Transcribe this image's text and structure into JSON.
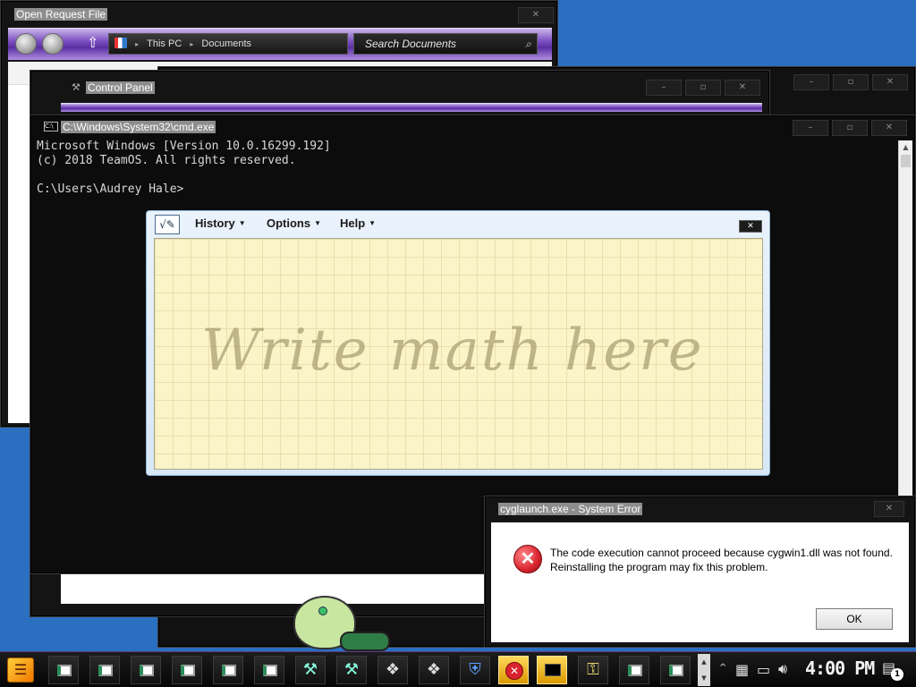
{
  "desktop": {
    "background_color": "#2a6fc0"
  },
  "open_request_file": {
    "title": "Open Request File",
    "close_glyph": "✕",
    "breadcrumb": [
      "This PC",
      "Documents"
    ],
    "search_placeholder": "Search Documents"
  },
  "control_panel": {
    "title": "Control Panel",
    "controls": {
      "minimize": "–",
      "maximize": "▫",
      "close": "✕"
    }
  },
  "cmd": {
    "title": "C:\\Windows\\System32\\cmd.exe",
    "lines": [
      "Microsoft Windows [Version 10.0.16299.192]",
      "(c) 2018 TeamOS. All rights reserved.",
      "",
      "C:\\Users\\Audrey Hale>"
    ],
    "controls": {
      "minimize": "–",
      "maximize": "▫",
      "close": "✕"
    }
  },
  "math_input": {
    "menus": [
      "History",
      "Options",
      "Help"
    ],
    "close_glyph": "✕",
    "hint": "Write math here",
    "colors": {
      "canvas": "#fbf4c8",
      "frame": "#d8e7f6"
    }
  },
  "error_dialog": {
    "title": "cyglaunch.exe - System Error",
    "close_glyph": "✕",
    "message_line1": "The code execution cannot proceed because cygwin1.dll was not found.",
    "message_line2": "Reinstalling the program may fix this problem.",
    "ok_label": "OK",
    "icon": "error-icon",
    "icon_color": "#d9232e"
  },
  "taskbar": {
    "clock": "4:00 PM",
    "notification_count": "1",
    "accent": "#5a3e86"
  }
}
